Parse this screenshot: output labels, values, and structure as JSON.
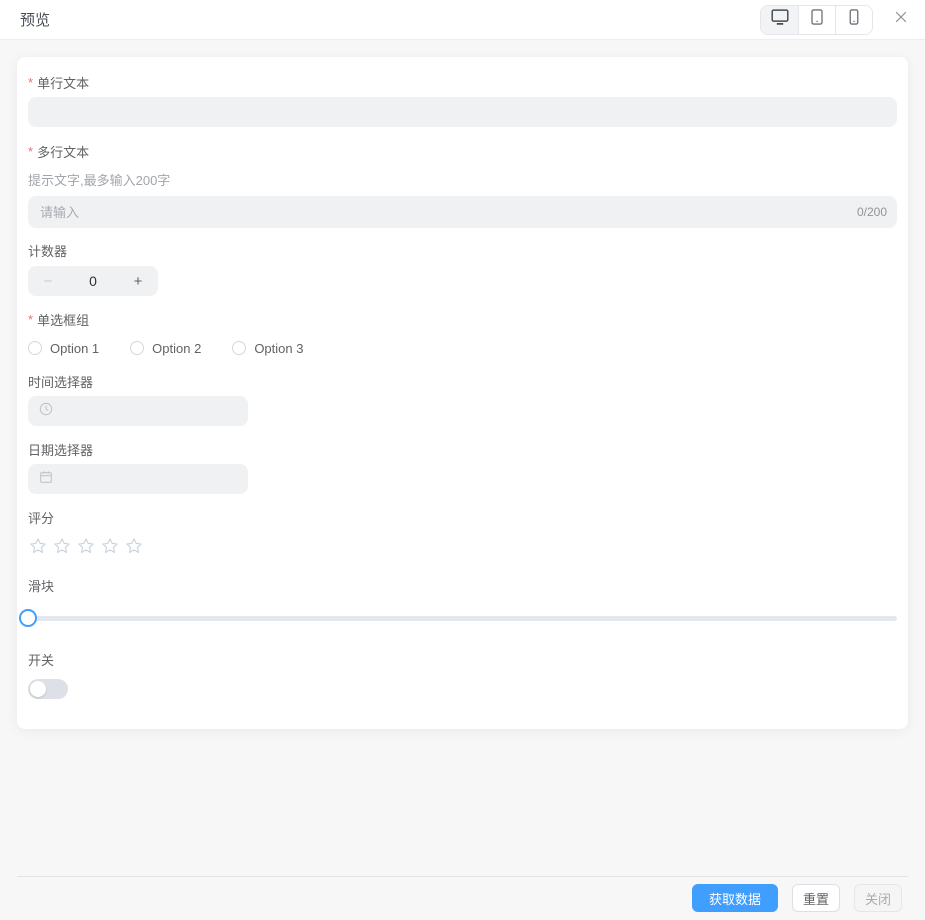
{
  "header": {
    "title": "预览",
    "devices": [
      {
        "name": "desktop",
        "active": true
      },
      {
        "name": "tablet",
        "active": false
      },
      {
        "name": "mobile",
        "active": false
      }
    ]
  },
  "form": {
    "required_marker": "*",
    "single_text": {
      "label": "单行文本",
      "required": true,
      "value": ""
    },
    "multi_text": {
      "label": "多行文本",
      "required": true,
      "hint": "提示文字,最多输入200字",
      "placeholder": "请输入",
      "counter": "0/200"
    },
    "counter": {
      "label": "计数器",
      "value": "0",
      "minus": "−",
      "plus": "+"
    },
    "radio_group": {
      "label": "单选框组",
      "required": true,
      "options": [
        "Option 1",
        "Option 2",
        "Option 3"
      ]
    },
    "time_picker": {
      "label": "时间选择器",
      "value": ""
    },
    "date_picker": {
      "label": "日期选择器",
      "value": ""
    },
    "rating": {
      "label": "评分",
      "stars": 5,
      "value": 0
    },
    "slider": {
      "label": "滑块",
      "value": 0
    },
    "switch": {
      "label": "开关",
      "on": false
    }
  },
  "footer": {
    "buttons": [
      {
        "label": "获取数据",
        "type": "primary"
      },
      {
        "label": "重置",
        "type": "default"
      },
      {
        "label": "关闭",
        "type": "muted"
      }
    ]
  },
  "colors": {
    "primary": "#409eff",
    "danger": "#f56c6c",
    "input_bg": "#f0f1f3"
  }
}
